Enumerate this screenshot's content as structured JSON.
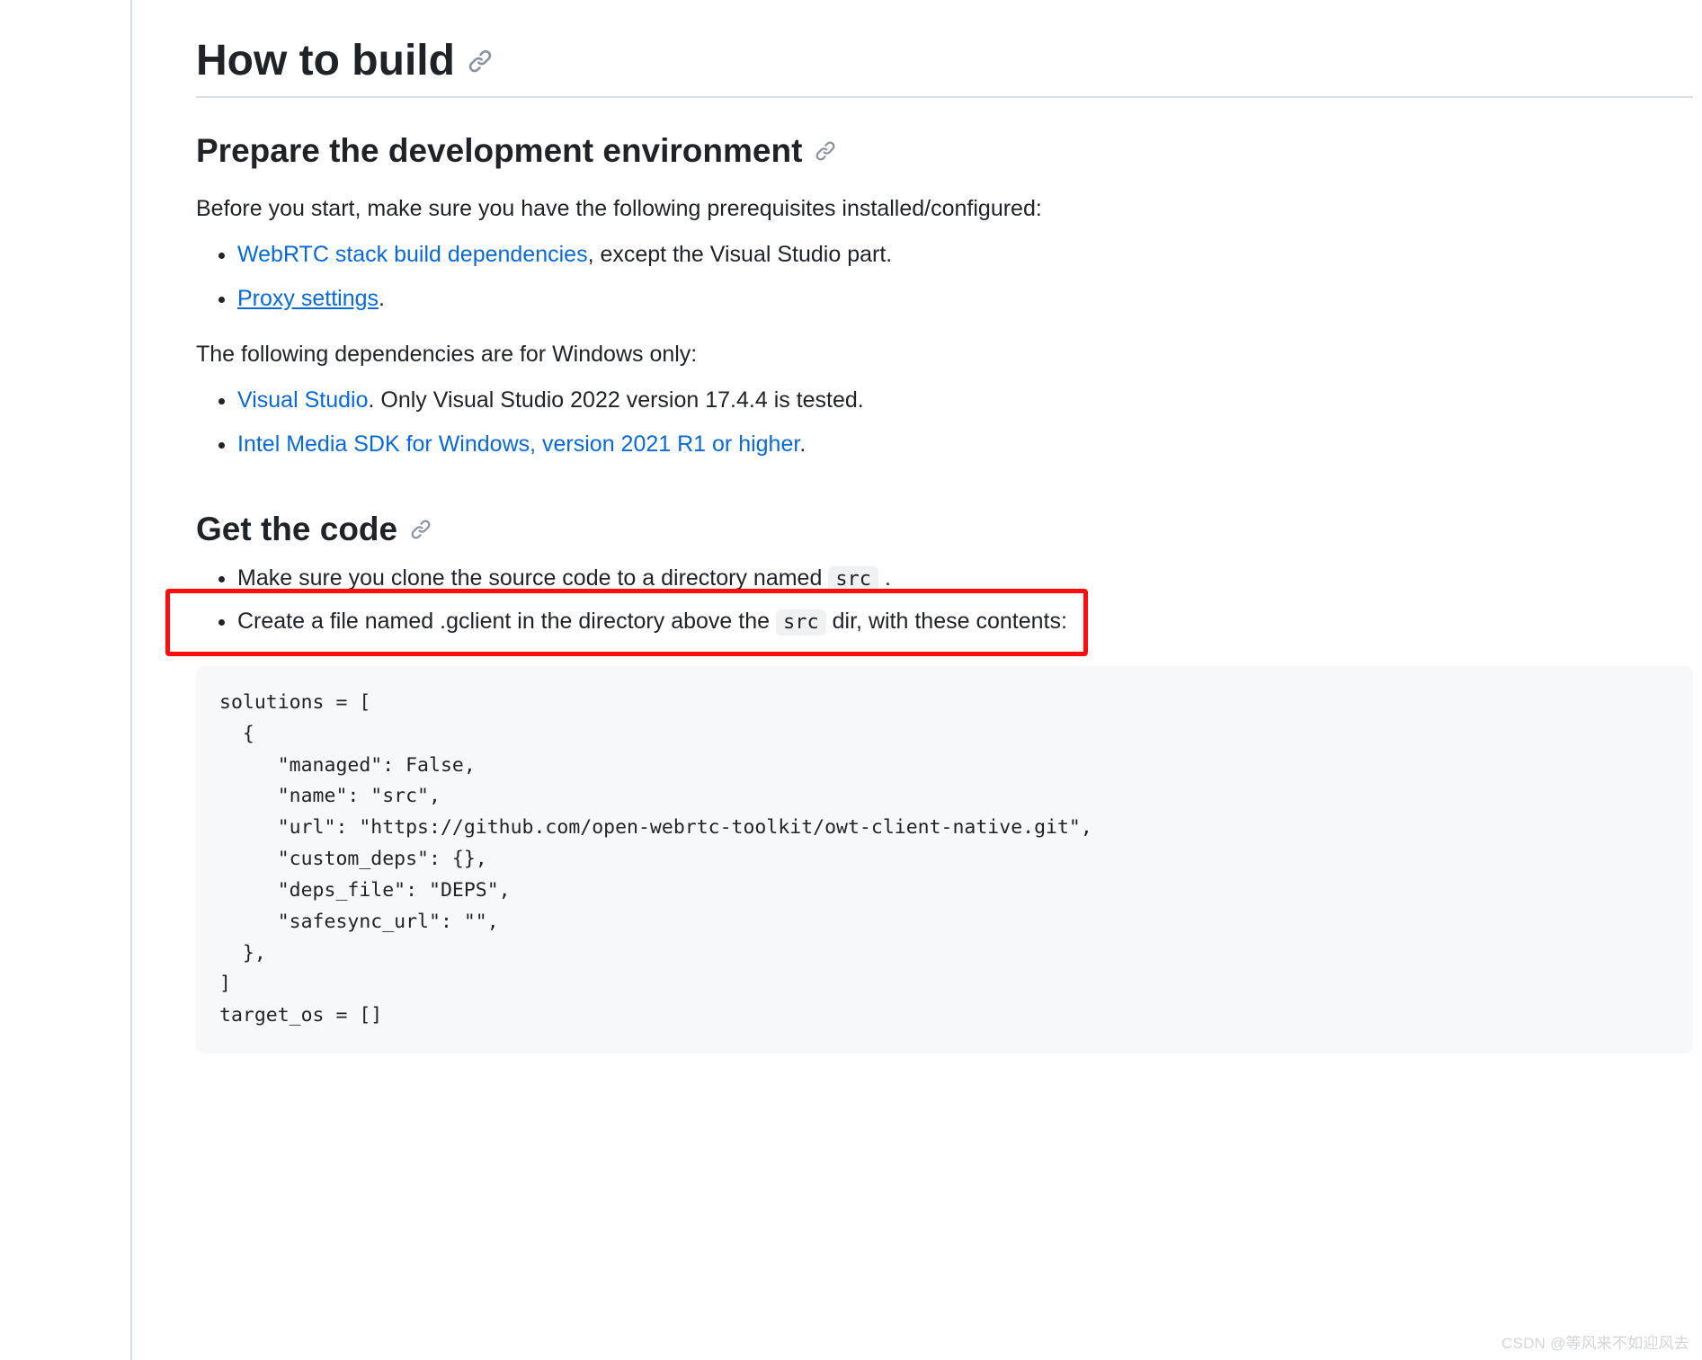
{
  "headings": {
    "h1": "How to build",
    "h2_prepare": "Prepare the development environment",
    "h2_getcode": "Get the code"
  },
  "paras": {
    "before_start": "Before you start, make sure you have the following prerequisites installed/configured:",
    "windows_only": "The following dependencies are for Windows only:"
  },
  "list_prereq": {
    "webrtc_link": "WebRTC stack build dependencies",
    "webrtc_tail": ", except the Visual Studio part.",
    "proxy_link": "Proxy settings",
    "proxy_tail": "."
  },
  "list_windows": {
    "vs_link": "Visual Studio",
    "vs_tail": ". Only Visual Studio 2022 version 17.4.4 is tested.",
    "intel_link": "Intel Media SDK for Windows, version 2021 R1 or higher",
    "intel_tail": "."
  },
  "list_getcode": {
    "clone_pre": "Make sure you clone the source code to a directory named ",
    "clone_code": "src",
    "clone_post": " .",
    "gclient_pre": "Create a file named .gclient in the directory above the ",
    "gclient_code": "src",
    "gclient_post": " dir, with these contents:"
  },
  "codeblock": "solutions = [\n  {\n     \"managed\": False,\n     \"name\": \"src\",\n     \"url\": \"https://github.com/open-webrtc-toolkit/owt-client-native.git\",\n     \"custom_deps\": {},\n     \"deps_file\": \"DEPS\",\n     \"safesync_url\": \"\",\n  },\n]\ntarget_os = []",
  "watermark": "CSDN @等风来不如迎风去"
}
